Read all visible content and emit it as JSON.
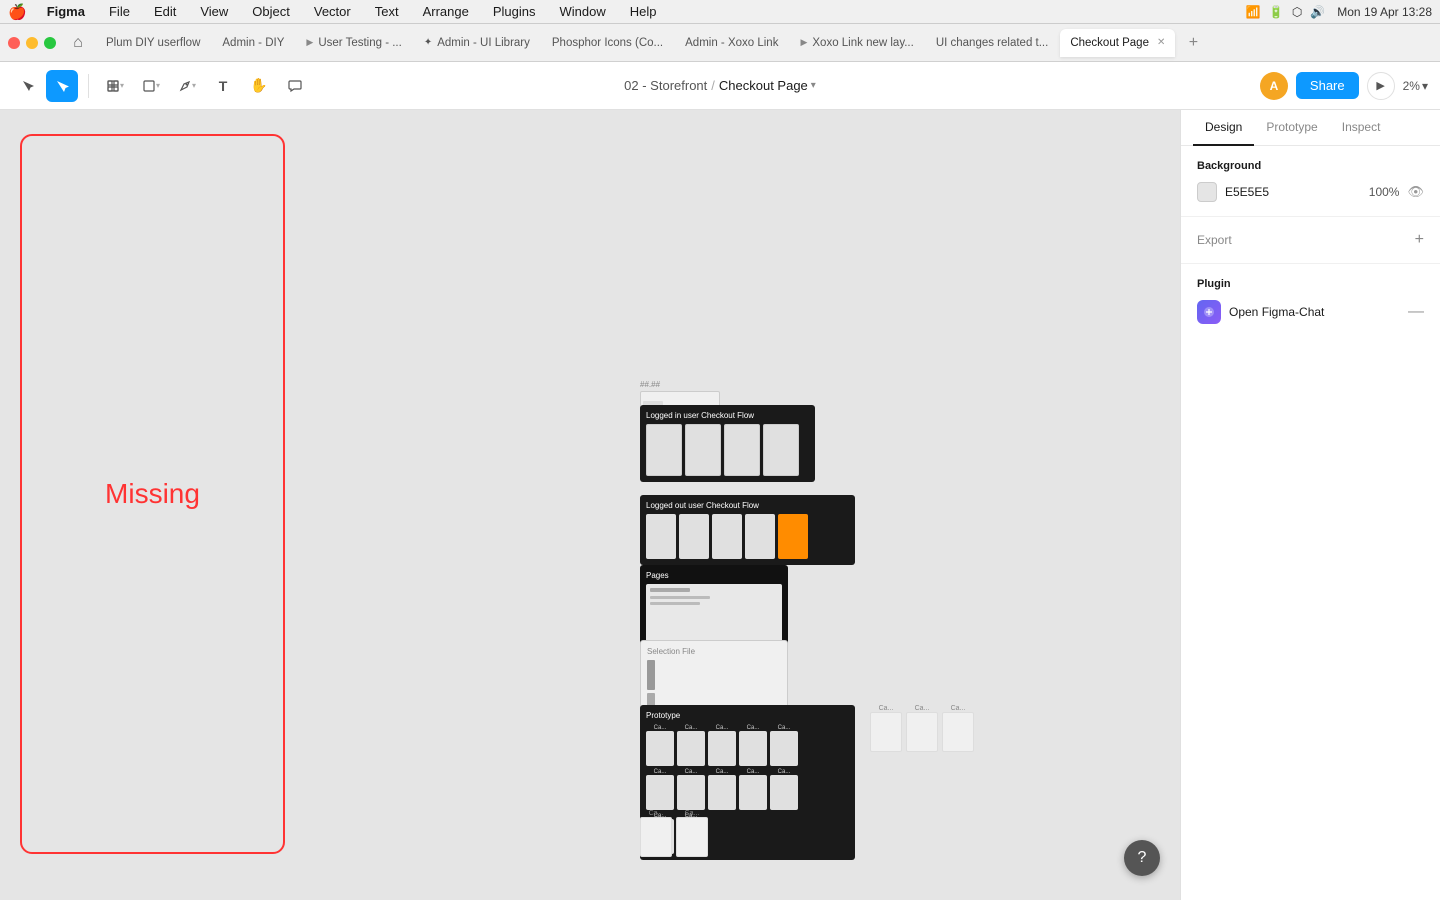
{
  "menubar": {
    "apple": "🍎",
    "figma": "Figma",
    "items": [
      "File",
      "Edit",
      "View",
      "Object",
      "Vector",
      "Text",
      "Arrange",
      "Plugins",
      "Window",
      "Help"
    ],
    "right": {
      "battery": "🔋",
      "time": "Mon 19 Apr  13:28"
    }
  },
  "tabs": [
    {
      "id": "plum",
      "label": "Plum DIY userflow",
      "type": "text",
      "active": false
    },
    {
      "id": "admin-diy",
      "label": "Admin - DIY",
      "type": "text",
      "active": false
    },
    {
      "id": "user-testing",
      "label": "User Testing - ...",
      "type": "play",
      "active": false
    },
    {
      "id": "admin-ui",
      "label": "Admin - UI Library",
      "type": "plugin",
      "active": false
    },
    {
      "id": "phosphor",
      "label": "Phosphor Icons (Co...",
      "type": "text",
      "active": false
    },
    {
      "id": "admin-xoxo",
      "label": "Admin - Xoxo Link",
      "type": "text",
      "active": false
    },
    {
      "id": "xoxo-new",
      "label": "Xoxo Link new lay...",
      "type": "play",
      "active": false
    },
    {
      "id": "ui-changes",
      "label": "UI changes related t...",
      "type": "text",
      "active": false
    },
    {
      "id": "checkout",
      "label": "Checkout Page",
      "type": "text",
      "active": true
    }
  ],
  "toolbar": {
    "breadcrumb_parent": "02 - Storefront",
    "breadcrumb_current": "Checkout Page",
    "share_label": "Share",
    "zoom_label": "2%",
    "avatar_initials": "A"
  },
  "canvas": {
    "frame_label": "",
    "missing_text": "Missing",
    "background_color": "#e5e5e5"
  },
  "right_panel": {
    "tabs": [
      "Design",
      "Prototype",
      "Inspect"
    ],
    "active_tab": "Design",
    "background_section": {
      "title": "Background",
      "color_hex": "E5E5E5",
      "opacity": "100%"
    },
    "export_section": {
      "label": "Export"
    },
    "plugin_section": {
      "title": "Plugin",
      "plugin_name": "Open Figma-Chat"
    }
  },
  "help": "?"
}
